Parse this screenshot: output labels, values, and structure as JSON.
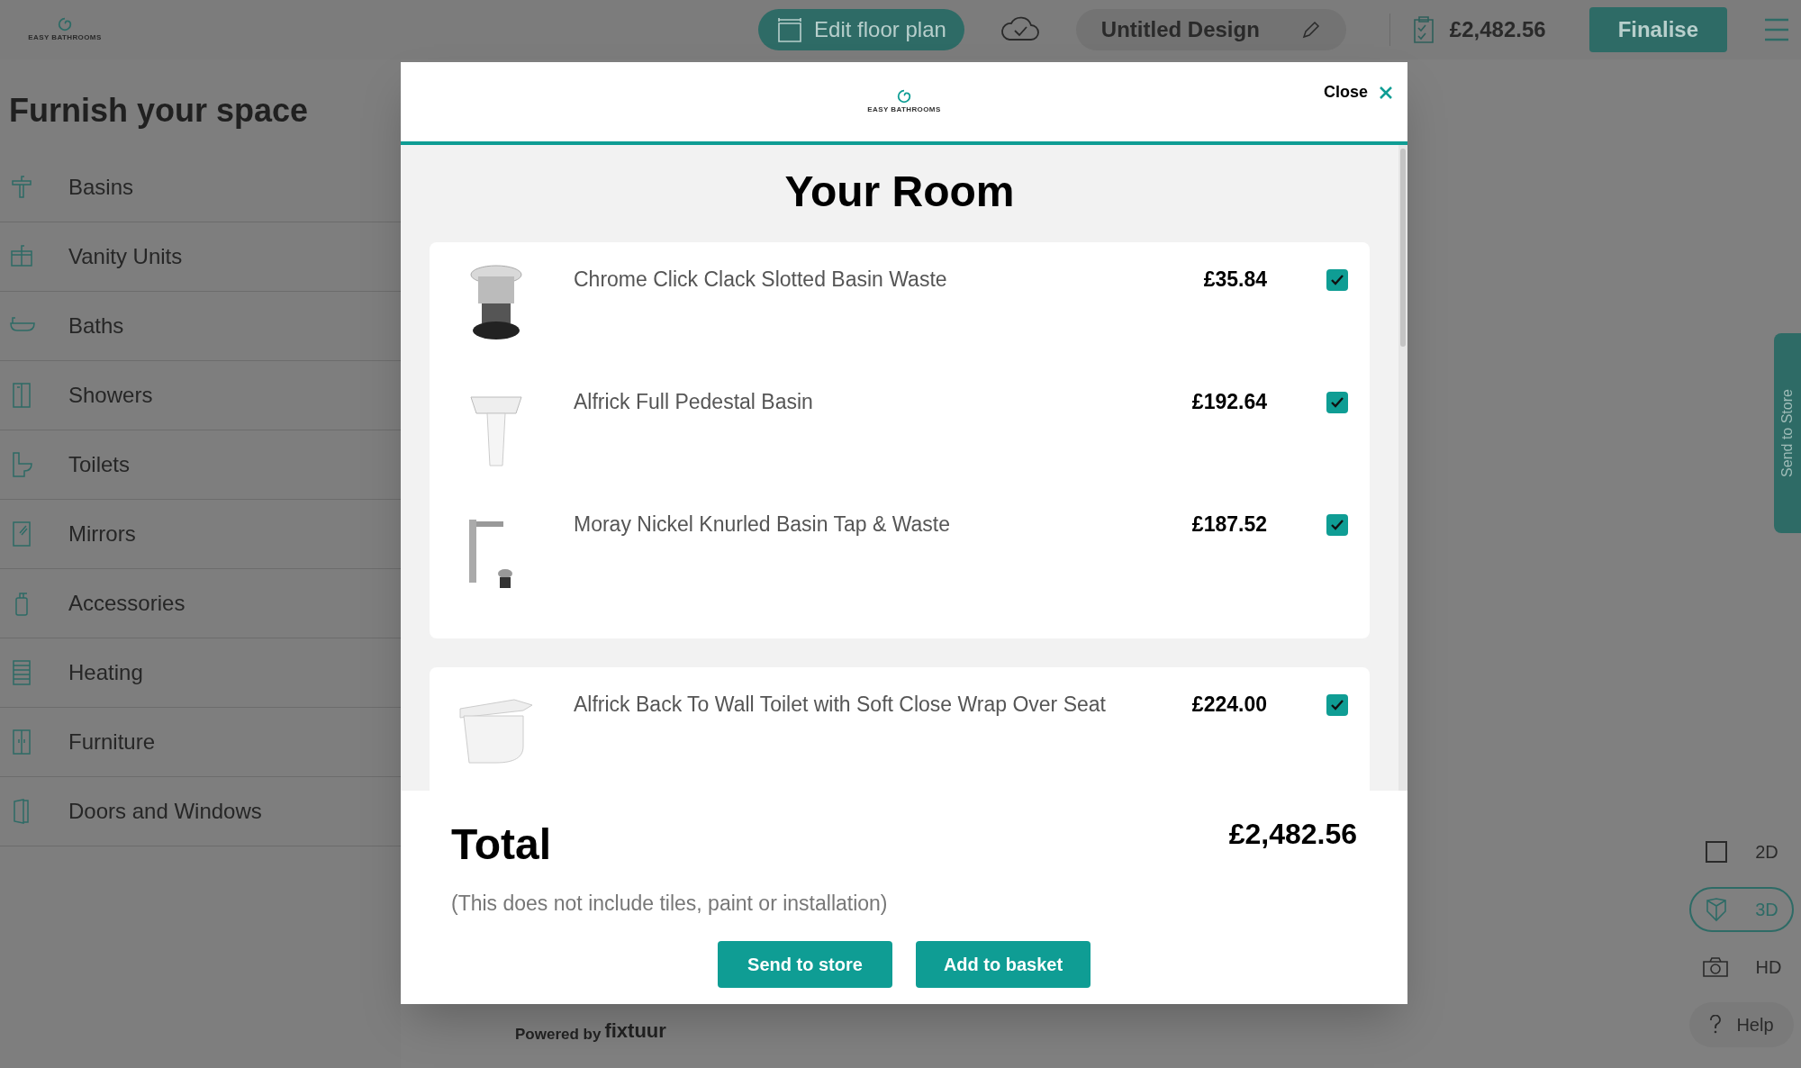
{
  "header": {
    "logo_text": "EASY BATHROOMS",
    "edit_floor_plan": "Edit floor plan",
    "design_name": "Untitled Design",
    "total": "£2,482.56",
    "finalise": "Finalise"
  },
  "sidebar": {
    "title": "Furnish your space",
    "items": [
      {
        "label": "Basins",
        "kind": "basin"
      },
      {
        "label": "Vanity Units",
        "kind": "vanity"
      },
      {
        "label": "Baths",
        "kind": "bath"
      },
      {
        "label": "Showers",
        "kind": "shower"
      },
      {
        "label": "Toilets",
        "kind": "toilet"
      },
      {
        "label": "Mirrors",
        "kind": "mirror"
      },
      {
        "label": "Accessories",
        "kind": "soap"
      },
      {
        "label": "Heating",
        "kind": "radiator"
      },
      {
        "label": "Furniture",
        "kind": "cabinet"
      },
      {
        "label": "Doors and Windows",
        "kind": "door"
      }
    ]
  },
  "modal": {
    "logo_text": "EASY BATHROOMS",
    "close": "Close",
    "title": "Your Room",
    "groups": [
      {
        "items": [
          {
            "name": "Chrome Click Clack Slotted Basin Waste",
            "price": "£35.84",
            "checked": true,
            "kind": "waste"
          },
          {
            "name": "Alfrick Full Pedestal Basin",
            "price": "£192.64",
            "checked": true,
            "kind": "basin"
          },
          {
            "name": "Moray Nickel Knurled Basin Tap & Waste",
            "price": "£187.52",
            "checked": true,
            "kind": "tap"
          }
        ]
      },
      {
        "items": [
          {
            "name": "Alfrick Back To Wall Toilet with Soft Close Wrap Over Seat",
            "price": "£224.00",
            "checked": true,
            "kind": "toilet"
          }
        ]
      }
    ],
    "total_label": "Total",
    "total": "£2,482.56",
    "note": "(This does not include tiles, paint or installation)",
    "buttons": [
      "Send to store",
      "Add to basket"
    ]
  },
  "powered_by": "Powered by",
  "powered_brand": "fixtuur",
  "send_tab": "Send to Store",
  "view_controls": [
    {
      "label": "2D",
      "kind": "square",
      "selected": false
    },
    {
      "label": "3D",
      "kind": "shield",
      "selected": true
    },
    {
      "label": "HD",
      "kind": "camera",
      "selected": false
    }
  ],
  "help": "Help"
}
